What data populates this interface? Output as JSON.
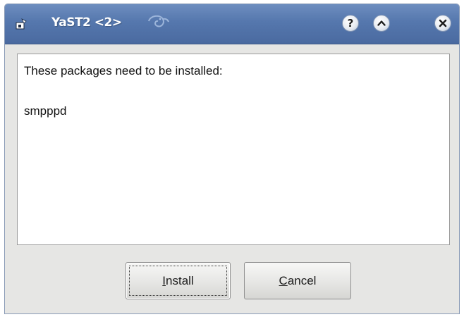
{
  "window": {
    "title": "YaST2 <2>",
    "icons": [
      "package-icon",
      "opensuse-chameleon-icon"
    ],
    "title_buttons": {
      "help_glyph": "?",
      "shade_glyph": "^",
      "close_glyph": "✕"
    },
    "colors": {
      "titlebar": "#5577ad",
      "window_bg": "#e6e6e4"
    }
  },
  "dialog": {
    "message": "These packages need to be installed:",
    "packages": [
      "smpppd"
    ]
  },
  "buttons": {
    "install_label": "Install",
    "cancel_label": "Cancel"
  }
}
